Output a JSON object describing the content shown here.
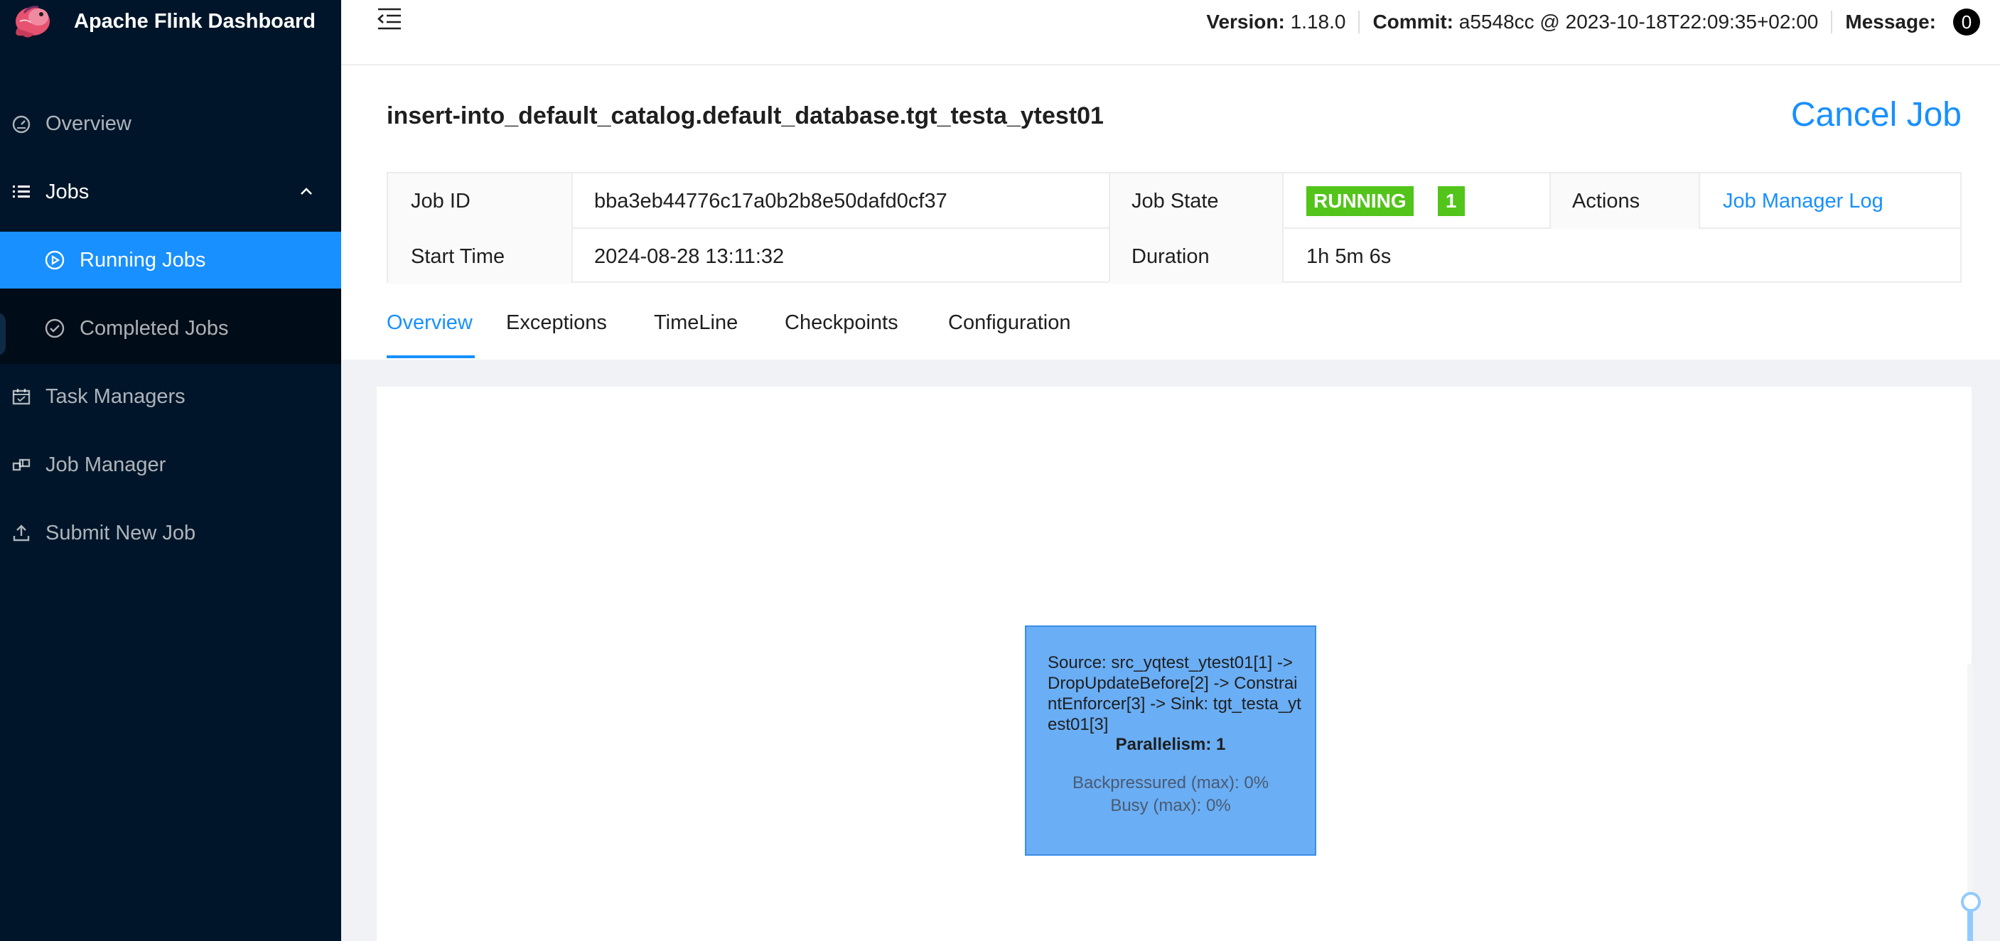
{
  "app": {
    "title": "Apache Flink Dashboard"
  },
  "sidebar": {
    "items": [
      {
        "label": "Overview",
        "icon": "dashboard-icon"
      },
      {
        "label": "Jobs",
        "icon": "list-icon"
      },
      {
        "label": "Task Managers",
        "icon": "calendar-icon"
      },
      {
        "label": "Job Manager",
        "icon": "build-icon"
      },
      {
        "label": "Submit New Job",
        "icon": "upload-icon"
      }
    ],
    "jobs_submenu": [
      {
        "label": "Running Jobs",
        "icon": "play-circle-icon",
        "active": true
      },
      {
        "label": "Completed Jobs",
        "icon": "check-circle-icon",
        "active": false
      }
    ]
  },
  "header": {
    "version_label": "Version:",
    "version_value": "1.18.0",
    "commit_label": "Commit:",
    "commit_value": "a5548cc @ 2023-10-18T22:09:35+02:00",
    "message_label": "Message:",
    "message_count": "0"
  },
  "job": {
    "title": "insert-into_default_catalog.default_database.tgt_testa_ytest01",
    "cancel_label": "Cancel Job",
    "job_id_label": "Job ID",
    "job_id": "bba3eb44776c17a0b2b8e50dafd0cf37",
    "job_state_label": "Job State",
    "job_state": "RUNNING",
    "job_state_count": "1",
    "actions_label": "Actions",
    "actions_link": "Job Manager Log",
    "start_time_label": "Start Time",
    "start_time": "2024-08-28 13:11:32",
    "duration_label": "Duration",
    "duration": "1h 5m 6s"
  },
  "tabs": [
    {
      "label": "Overview",
      "active": true
    },
    {
      "label": "Exceptions",
      "active": false
    },
    {
      "label": "TimeLine",
      "active": false
    },
    {
      "label": "Checkpoints",
      "active": false
    },
    {
      "label": "Configuration",
      "active": false
    }
  ],
  "graph": {
    "node": {
      "description": "Source: src_yqtest_ytest01[1] -> DropUpdateBefore[2] -> ConstraintEnforcer[3] -> Sink: tgt_testa_ytest01[3]",
      "parallelism": "Parallelism: 1",
      "backpressured": "Backpressured (max): 0%",
      "busy": "Busy (max): 0%"
    },
    "zoom_level": 0.15
  },
  "colors": {
    "sidebar_bg": "#001529",
    "accent": "#1890ff",
    "running": "#52c41a",
    "node_fill": "#6aaef5"
  }
}
